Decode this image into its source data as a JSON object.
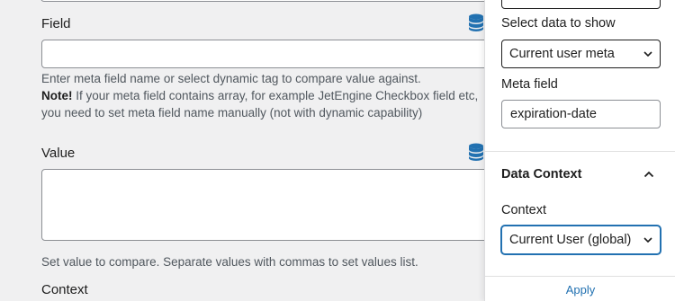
{
  "left": {
    "field_label": "Field",
    "field_value": "",
    "field_help_line1": "Enter meta field name or select dynamic tag to compare value against.",
    "field_help_note_bold": "Note!",
    "field_help_note_rest": " If your meta field contains array, for example JetEngine Checkbox field etc,",
    "field_help_line3": "you need to set meta field name manually (not with dynamic capability)",
    "value_label": "Value",
    "value_value": "",
    "value_help": "Set value to compare. Separate values with commas to set values list.",
    "context_label": "Context",
    "dynamic_icon": "database-icon"
  },
  "panel": {
    "select_data_label": "Select data to show",
    "select_data_value": "Current user meta",
    "meta_field_label": "Meta field",
    "meta_field_value": "expiration-date",
    "data_context_title": "Data Context",
    "context_label": "Context",
    "context_value": "Current User (global)",
    "apply_label": "Apply",
    "accent_color": "#2271b1"
  }
}
